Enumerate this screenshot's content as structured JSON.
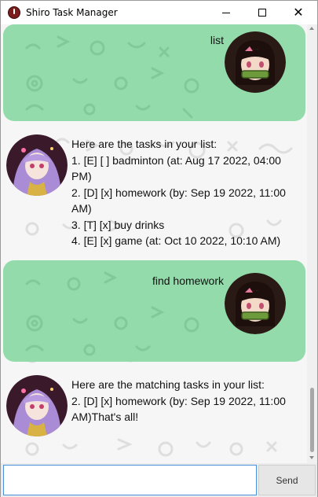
{
  "window": {
    "title": "Shiro Task Manager",
    "close_glyph": "✕"
  },
  "colors": {
    "user_bubble": "#93dbab",
    "background_pattern": "#f6f6f6",
    "input_border": "#4a90d9"
  },
  "icons": {
    "app": "power-icon",
    "user_avatar": "user-avatar",
    "bot_avatar": "bot-avatar"
  },
  "messages": [
    {
      "sender": "user",
      "text": "list"
    },
    {
      "sender": "bot",
      "text": "Here are the tasks in your list:\n1. [E] [ ] badminton (at: Aug 17 2022, 04:00\nPM)\n2. [D] [x] homework (by: Sep 19 2022, 11:00\nAM)\n3. [T] [x] buy drinks\n4. [E] [x] game (at: Oct 10 2022, 10:10 AM)"
    },
    {
      "sender": "user",
      "text": "find homework"
    },
    {
      "sender": "bot",
      "text": "Here are the matching tasks in your list:\n2. [D] [x] homework (by: Sep 19 2022, 11:00\nAM)That's all!"
    }
  ],
  "input": {
    "value": "",
    "send_label": "Send"
  }
}
